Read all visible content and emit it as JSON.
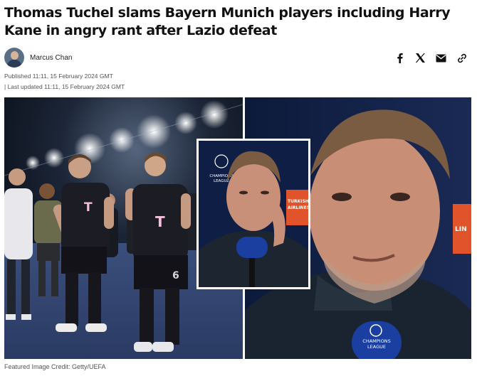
{
  "article": {
    "headline": "Thomas Tuchel slams Bayern Munich players including Harry Kane in angry rant after Lazio defeat",
    "author": "Marcus Chan",
    "published": "Published 11:11, 15 February 2024 GMT",
    "updated": "| Last updated 11:11, 15 February 2024 GMT",
    "image_caption": "Featured Image Credit: Getty/UEFA"
  },
  "share": {
    "icons": [
      "facebook-icon",
      "x-icon",
      "email-icon",
      "link-icon"
    ]
  },
  "image": {
    "jersey_logo": "T",
    "badge_text": "CHAMPIONS LEAGUE",
    "badge_text_1": "CHAMPIONS",
    "badge_text_2": "LEAGUE",
    "board_text_1": "TURKISH",
    "board_text_2": "AIRLINES",
    "shirt_number": "6",
    "colors": {
      "background": "#0b1526",
      "jersey": "#1c1c24",
      "ucl_blue": "#1a3fa0",
      "board_orange": "#e0532b"
    }
  }
}
